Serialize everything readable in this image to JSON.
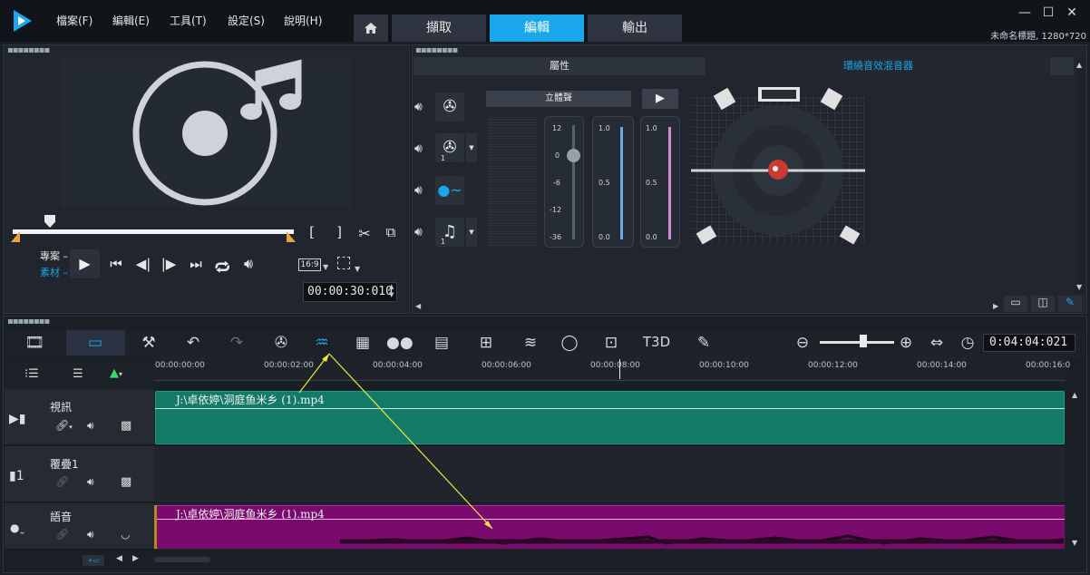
{
  "menu": [
    "檔案(F)",
    "編輯(E)",
    "工具(T)",
    "設定(S)",
    "說明(H)"
  ],
  "nav_tabs": [
    "擷取",
    "編輯",
    "輸出"
  ],
  "window_buttons": {
    "minimize": "—",
    "maximize": "☐",
    "close": "✕"
  },
  "project_info": "未命名標題, 1280*720",
  "preview": {
    "mode_project": "專案",
    "mode_clip": "素材",
    "aspect": "16:9",
    "timecode": "00:00:30:010"
  },
  "mixer": {
    "tab_properties": "屬性",
    "tab_surround": "環繞音效混音器",
    "stereo_label": "立體聲",
    "track_badge_1": "1",
    "track_badge_2": "1",
    "meter_scale_1": [
      "12",
      "0",
      "-6",
      "-12",
      "-36"
    ],
    "meter_scale_2": [
      "1.0",
      "0.5",
      "0.0"
    ],
    "meter_scale_3": [
      "1.0",
      "0.5",
      "0.0"
    ]
  },
  "timeline": {
    "timecode": "0:04:04:021",
    "ruler_ticks": [
      "00:00:00:00",
      "00:00:02:00",
      "00:00:04:00",
      "00:00:06:00",
      "00:00:08:00",
      "00:00:10:00",
      "00:00:12:00",
      "00:00:14:00",
      "00:00:16:0"
    ],
    "tracks": [
      {
        "name": "視訊",
        "clip": "J:\\卓依婷\\洞庭鱼米乡 (1).mp4"
      },
      {
        "name": "覆疊1",
        "clip": ""
      },
      {
        "name": "語音",
        "clip": "J:\\卓依婷\\洞庭鱼米乡 (1).mp4"
      }
    ]
  },
  "colors": {
    "accent": "#1aa7ec",
    "video_clip": "#137a68",
    "audio_clip": "#7b0a6e"
  }
}
